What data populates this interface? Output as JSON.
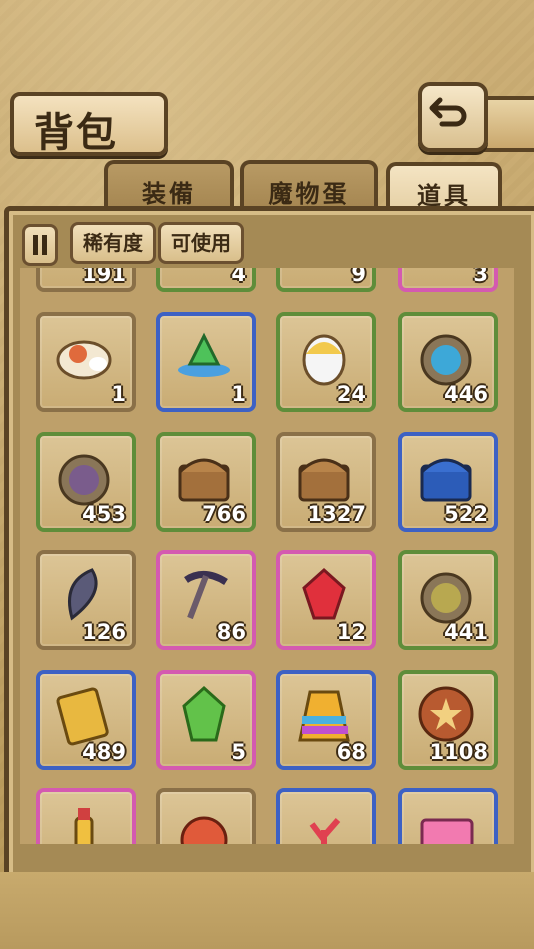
{
  "header": {
    "title": "背包",
    "back_icon": "back-arrow-icon"
  },
  "tabs": [
    {
      "label": "装備",
      "active": false
    },
    {
      "label": "魔物蛋",
      "active": false
    },
    {
      "label": "道具",
      "active": true
    }
  ],
  "filters": {
    "sort_icon": "pause-toggle-icon",
    "rarity_label": "稀有度",
    "usable_label": "可使用"
  },
  "items": [
    {
      "icon": "rice-bag-icon",
      "count": "1",
      "border": "brown"
    },
    {
      "icon": "green-crystal-icon",
      "count": "1",
      "border": "blue"
    },
    {
      "icon": "egg-icon",
      "count": "24",
      "border": "green"
    },
    {
      "icon": "blue-medal-icon",
      "count": "446",
      "border": "green"
    },
    {
      "icon": "purple-medal-icon",
      "count": "453",
      "border": "green"
    },
    {
      "icon": "wood-chest-icon",
      "count": "766",
      "border": "green"
    },
    {
      "icon": "wood-chest-icon",
      "count": "1327",
      "border": "brown"
    },
    {
      "icon": "blue-chest-icon",
      "count": "522",
      "border": "blue"
    },
    {
      "icon": "feather-icon",
      "count": "126",
      "border": "brown"
    },
    {
      "icon": "pickaxe-icon",
      "count": "86",
      "border": "pink"
    },
    {
      "icon": "red-gem-icon",
      "count": "12",
      "border": "pink"
    },
    {
      "icon": "green-medal-icon",
      "count": "441",
      "border": "green"
    },
    {
      "icon": "gold-tag-icon",
      "count": "489",
      "border": "blue"
    },
    {
      "icon": "green-gem-icon",
      "count": "5",
      "border": "pink"
    },
    {
      "icon": "rainbow-cloth-icon",
      "count": "68",
      "border": "blue"
    },
    {
      "icon": "bronze-coin-icon",
      "count": "1108",
      "border": "green"
    },
    {
      "icon": "potion-bottle-icon",
      "count": "",
      "border": "pink"
    },
    {
      "icon": "crab-claw-icon",
      "count": "",
      "border": "brown"
    },
    {
      "icon": "coral-icon",
      "count": "",
      "border": "blue"
    },
    {
      "icon": "pink-ticket-icon",
      "count": "",
      "border": "blue"
    }
  ],
  "top_row_partial": [
    {
      "border": "brown",
      "count": "191"
    },
    {
      "border": "green",
      "count": "4"
    },
    {
      "border": "green",
      "count": "9"
    },
    {
      "border": "pink",
      "count": "3"
    }
  ]
}
